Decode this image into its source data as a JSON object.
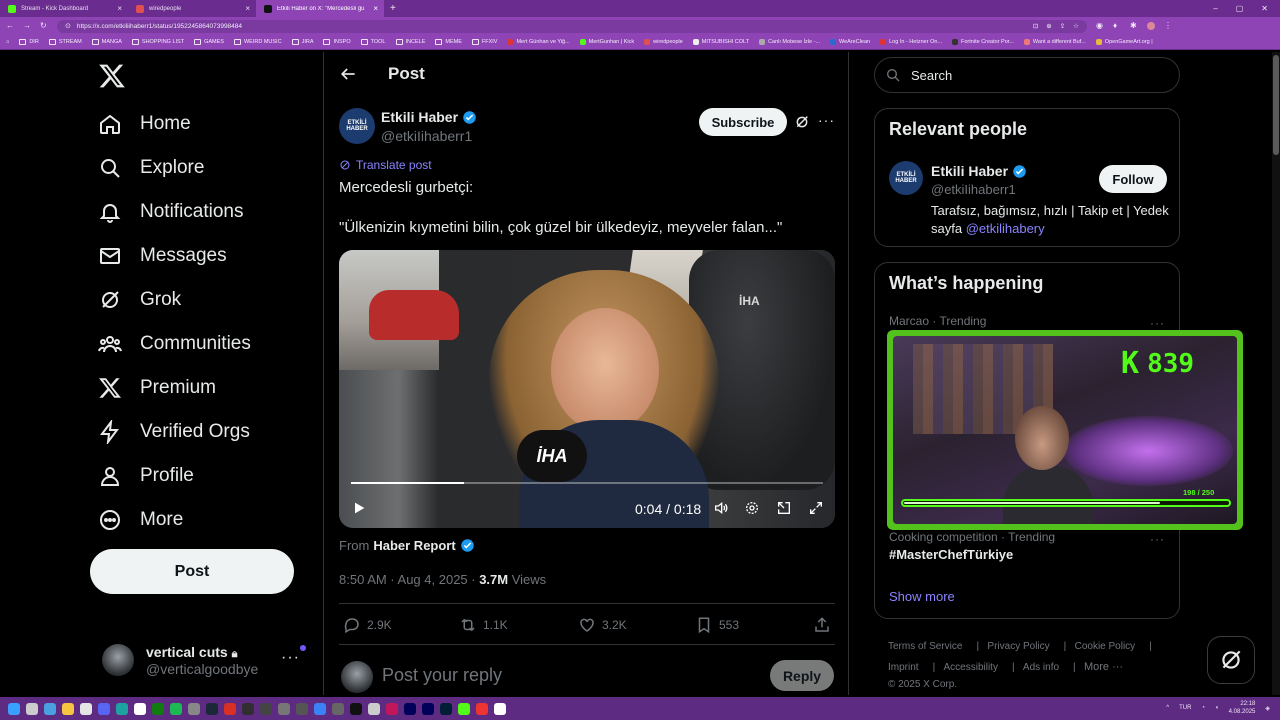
{
  "browser": {
    "tabs": [
      {
        "label": "Stream - Kick Dashboard",
        "color": "#53fc18"
      },
      {
        "label": "wiredpeople",
        "color": "#e05050"
      },
      {
        "label": "Etkili Haber on X: \"Mercedesli gu",
        "color": "#111111"
      }
    ],
    "url": "https://x.com/etkiliihaberr1/status/1952245864073998484",
    "bookmarks": [
      "DIR",
      "STREAM",
      "MANGA",
      "SHOPPING LIST",
      "GAMES",
      "WEIRD MUSIC",
      "JIRA",
      "INSPO",
      "TOOL",
      "INCELE",
      "MEME",
      "FFXIV",
      "Mert Günhan ve Yiğ...",
      "MertGunhan | Kick",
      "wiredpeople",
      "MITSUBISHI COLT",
      "Canlı Mobese İzle -...",
      "WeAreClean",
      "Log In - Hetzner On...",
      "Fortnite Creator Por...",
      "Want a different Buf...",
      "OpenGameArt.org |"
    ]
  },
  "nav": {
    "items": [
      {
        "label": "Home",
        "icon": "home-icon"
      },
      {
        "label": "Explore",
        "icon": "search-icon"
      },
      {
        "label": "Notifications",
        "icon": "bell-icon"
      },
      {
        "label": "Messages",
        "icon": "mail-icon"
      },
      {
        "label": "Grok",
        "icon": "grok-icon"
      },
      {
        "label": "Communities",
        "icon": "communities-icon"
      },
      {
        "label": "Premium",
        "icon": "x-logo-icon"
      },
      {
        "label": "Verified Orgs",
        "icon": "bolt-icon"
      },
      {
        "label": "Profile",
        "icon": "person-icon"
      },
      {
        "label": "More",
        "icon": "more-circle-icon"
      }
    ],
    "post_label": "Post",
    "account": {
      "name": "vertical cuts",
      "handle": "@verticalgoodbye",
      "more": "···"
    }
  },
  "main": {
    "header_title": "Post",
    "tweet": {
      "avatar_text": "ETKİLİ HABER",
      "name": "Etkili Haber",
      "handle": "@etkiIihaberr1",
      "subscribe_label": "Subscribe",
      "more": "···",
      "translate_label": "Translate post",
      "text_line1": "Mercedesli gurbetçi:",
      "text_line2": "\"Ülkenizin kıymetini bilin, çok güzel bir ülkedeyiz, meyveler falan...\"",
      "video": {
        "time": "0:04 / 0:18",
        "progress": 0.24,
        "watermark": "İHA",
        "mic_label": "İHA"
      },
      "from_label": "From",
      "from_name": "Haber Report",
      "time": "8:50 AM · Aug 4, 2025 · ",
      "views_count": "3.7M",
      "views_label": " Views",
      "stats": {
        "replies": "2.9K",
        "reposts": "1.1K",
        "likes": "3.2K",
        "bookmarks": "553"
      }
    },
    "reply_placeholder": "Post your reply",
    "reply_label": "Reply"
  },
  "sidebar": {
    "search_placeholder": "Search",
    "relevant": {
      "title": "Relevant people",
      "avatar_text": "ETKİLİ HABER",
      "name": "Etkili Haber",
      "handle": "@etkiIihaberr1",
      "follow_label": "Follow",
      "bio": "Tarafsız, bağımsız, hızlı | Takip et | Yedek sayfa ",
      "bio_link": "@etkilihabery"
    },
    "happening": {
      "title": "What’s happening",
      "trends": [
        {
          "meta": "Marcao · Trending",
          "name": ""
        },
        {
          "meta": "Cooking competition · Trending",
          "name": "#MasterChefTürkiye"
        }
      ],
      "show_more": "Show more"
    },
    "footer": [
      "Terms of Service",
      "Privacy Policy",
      "Cookie Policy",
      "Imprint",
      "Accessibility",
      "Ads info",
      "More ···",
      "© 2025 X Corp."
    ]
  },
  "overlay": {
    "followers": "839",
    "hp_text": "198 / 250",
    "hp_value": 198,
    "hp_max": 250,
    "accent": "#53fc18"
  },
  "taskbar": {
    "lang": "TUR",
    "time": "22:18",
    "date": "4.08.2025"
  }
}
